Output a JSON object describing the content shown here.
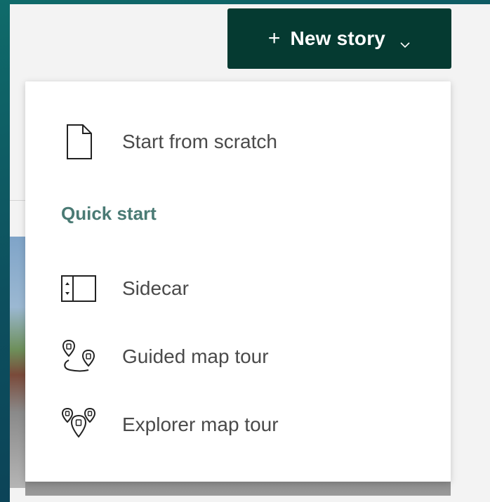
{
  "header": {
    "new_story_label": "New story",
    "plus_symbol": "+",
    "chevron_icon": "chevron-down-icon"
  },
  "menu": {
    "start_from_scratch": {
      "label": "Start from scratch",
      "icon": "blank-document-icon"
    },
    "quick_start_heading": "Quick start",
    "items": [
      {
        "label": "Sidecar",
        "icon": "sidecar-layout-icon"
      },
      {
        "label": "Guided map tour",
        "icon": "guided-map-tour-icon"
      },
      {
        "label": "Explorer map tour",
        "icon": "explorer-map-tour-icon"
      }
    ]
  },
  "colors": {
    "button_bg": "#053a31",
    "heading": "#4a7a74",
    "item_text": "#4a4a4a"
  }
}
